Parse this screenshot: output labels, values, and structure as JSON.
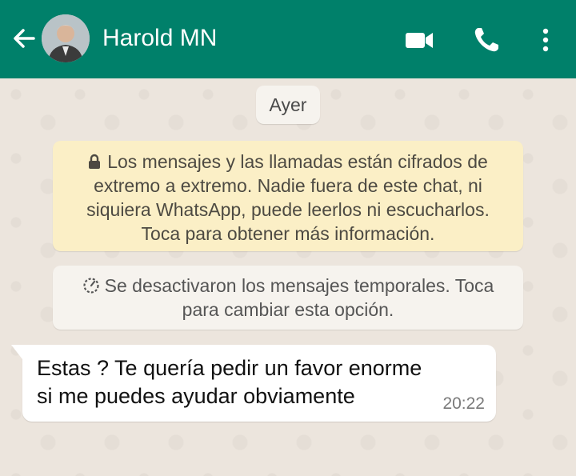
{
  "header": {
    "contact_name": "Harold MN",
    "icons": [
      "back-arrow-icon",
      "video-call-icon",
      "voice-call-icon",
      "more-options-icon"
    ],
    "background_color": "#00806a"
  },
  "chat": {
    "date_chip": "Ayer",
    "encryption_notice": {
      "lines": [
        "Los mensajes y las llamadas están cifrados de",
        "extremo a extremo. Nadie fuera de este chat, ni",
        "siquiera WhatsApp, puede leerlos ni escucharlos.",
        "Toca para obtener más información."
      ],
      "icon": "lock-icon",
      "background_color": "#fbefc6"
    },
    "temporary_notice": {
      "lines": [
        "Se desactivaron los mensajes temporales. Toca",
        "para cambiar esta opción."
      ],
      "icon": "timer-icon"
    },
    "messages": [
      {
        "direction": "incoming",
        "lines": [
          "Estas ? Te quería pedir un favor enorme",
          "si me puedes ayudar obviamente"
        ],
        "time": "20:22"
      }
    ]
  }
}
